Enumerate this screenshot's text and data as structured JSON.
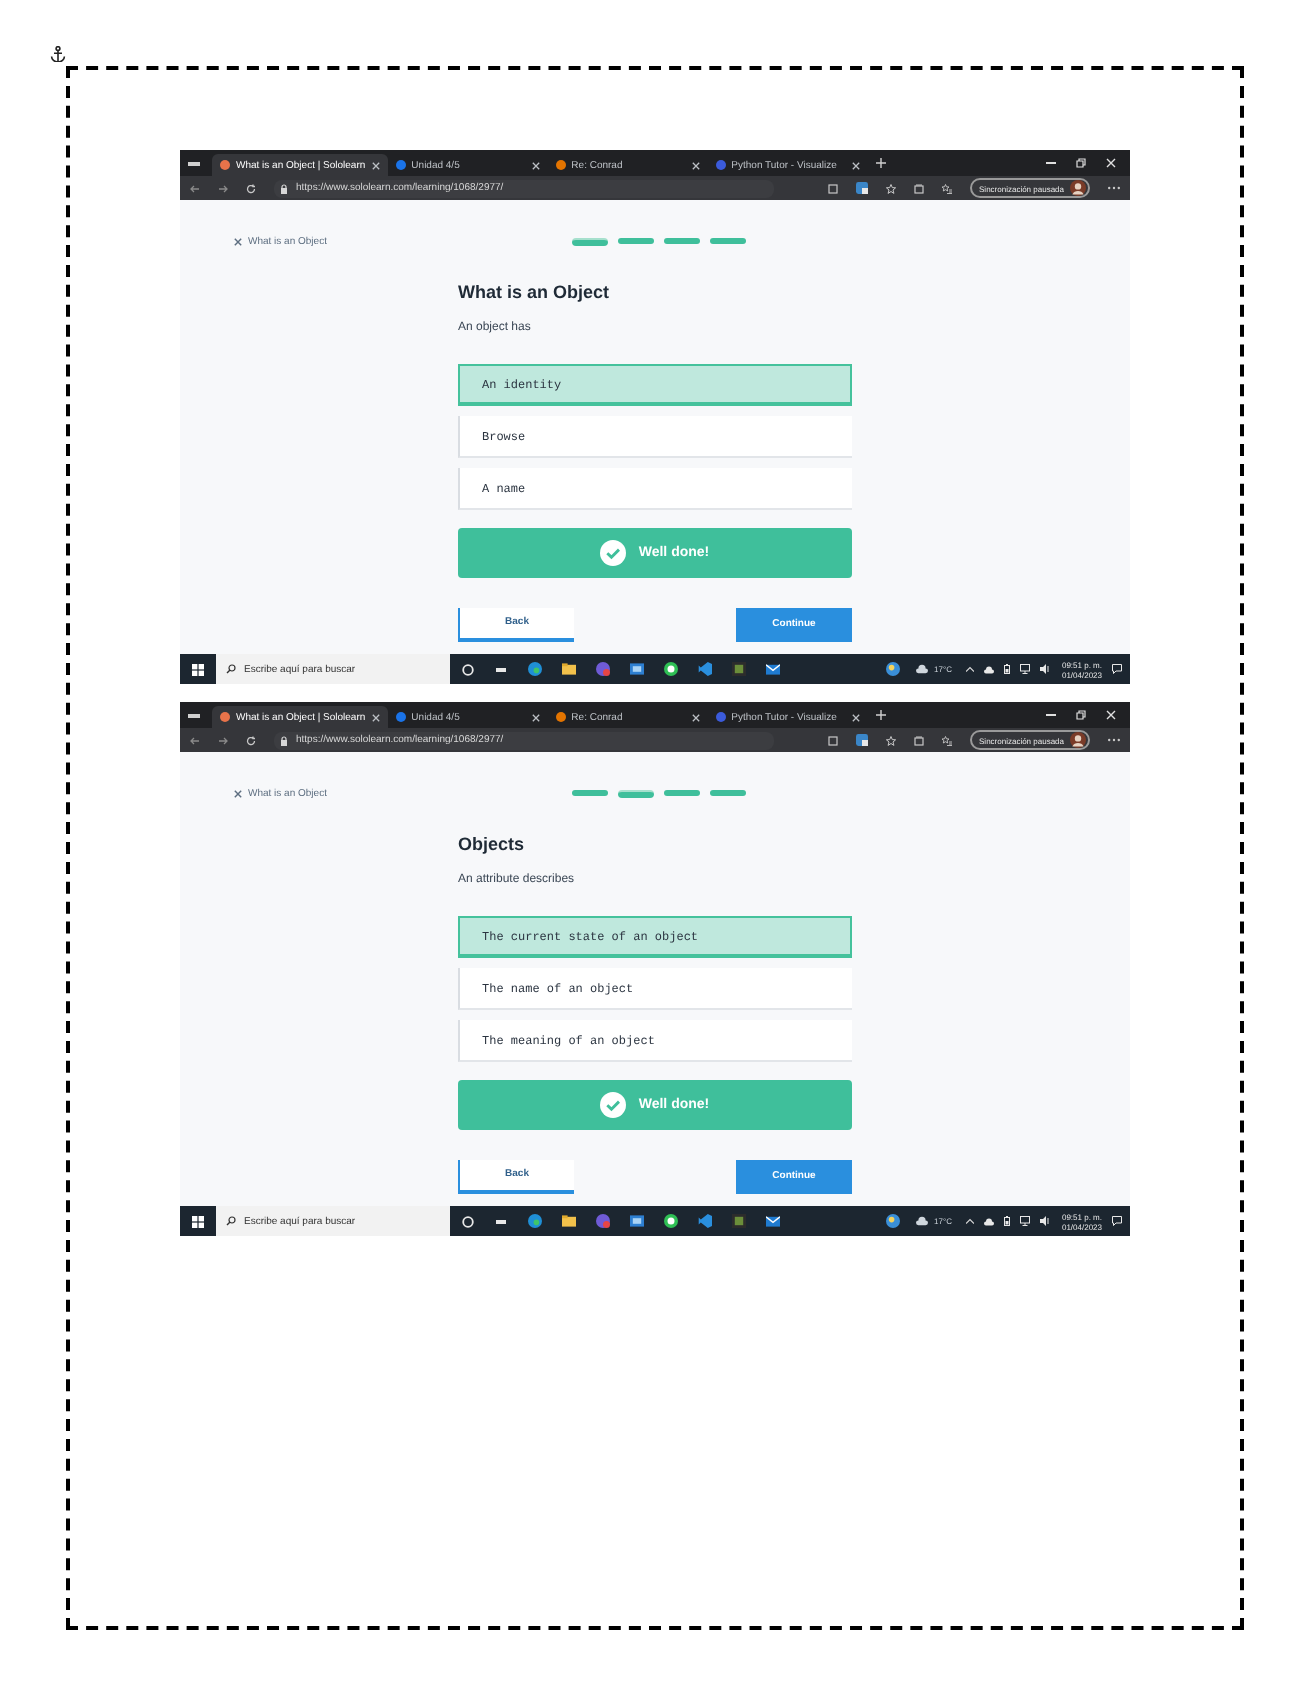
{
  "screenshots": [
    {
      "browser": {
        "tabs": [
          {
            "title": "What is an Object | Sololearn",
            "selected": true
          },
          {
            "title": "Unidad 4/5",
            "selected": false
          },
          {
            "title": "Re: Conrad",
            "selected": false
          },
          {
            "title": "Python Tutor - Visualize",
            "selected": false
          }
        ],
        "url": "https://www.sololearn.com/learning/1068/2977/",
        "sync_status": "Sincronización pausada"
      },
      "lesson": {
        "close_link": "What is an Object",
        "progress": [
          {
            "selected": true
          },
          {
            "selected": false
          },
          {
            "selected": false
          },
          {
            "selected": false
          }
        ],
        "title": "What is an Object",
        "prompt": "An object has",
        "options": [
          {
            "text": "An identity",
            "selected": true
          },
          {
            "text": "Browse",
            "selected": false
          },
          {
            "text": "A name",
            "selected": false
          }
        ],
        "feedback": "Well done!",
        "back_button": "Back",
        "continue_button": "Continue"
      },
      "taskbar": {
        "search_placeholder": "Escribe aquí para buscar",
        "temperature": "17°C",
        "time": "09:51 p. m.",
        "date": "01/04/2023"
      }
    },
    {
      "browser": {
        "tabs": [
          {
            "title": "What is an Object | Sololearn",
            "selected": true
          },
          {
            "title": "Unidad 4/5",
            "selected": false
          },
          {
            "title": "Re: Conrad",
            "selected": false
          },
          {
            "title": "Python Tutor - Visualize",
            "selected": false
          }
        ],
        "url": "https://www.sololearn.com/learning/1068/2977/",
        "sync_status": "Sincronización pausada"
      },
      "lesson": {
        "close_link": "What is an Object",
        "progress": [
          {
            "selected": false
          },
          {
            "selected": true
          },
          {
            "selected": false
          },
          {
            "selected": false
          }
        ],
        "title": "Objects",
        "prompt": "An attribute describes",
        "options": [
          {
            "text": "The current state of an object",
            "selected": true
          },
          {
            "text": "The name of an object",
            "selected": false
          },
          {
            "text": "The meaning of an object",
            "selected": false
          }
        ],
        "feedback": "Well done!",
        "back_button": "Back",
        "continue_button": "Continue"
      },
      "taskbar": {
        "search_placeholder": "Escribe aquí para buscar",
        "temperature": "17°C",
        "time": "09:51 p. m.",
        "date": "01/04/2023"
      }
    }
  ]
}
